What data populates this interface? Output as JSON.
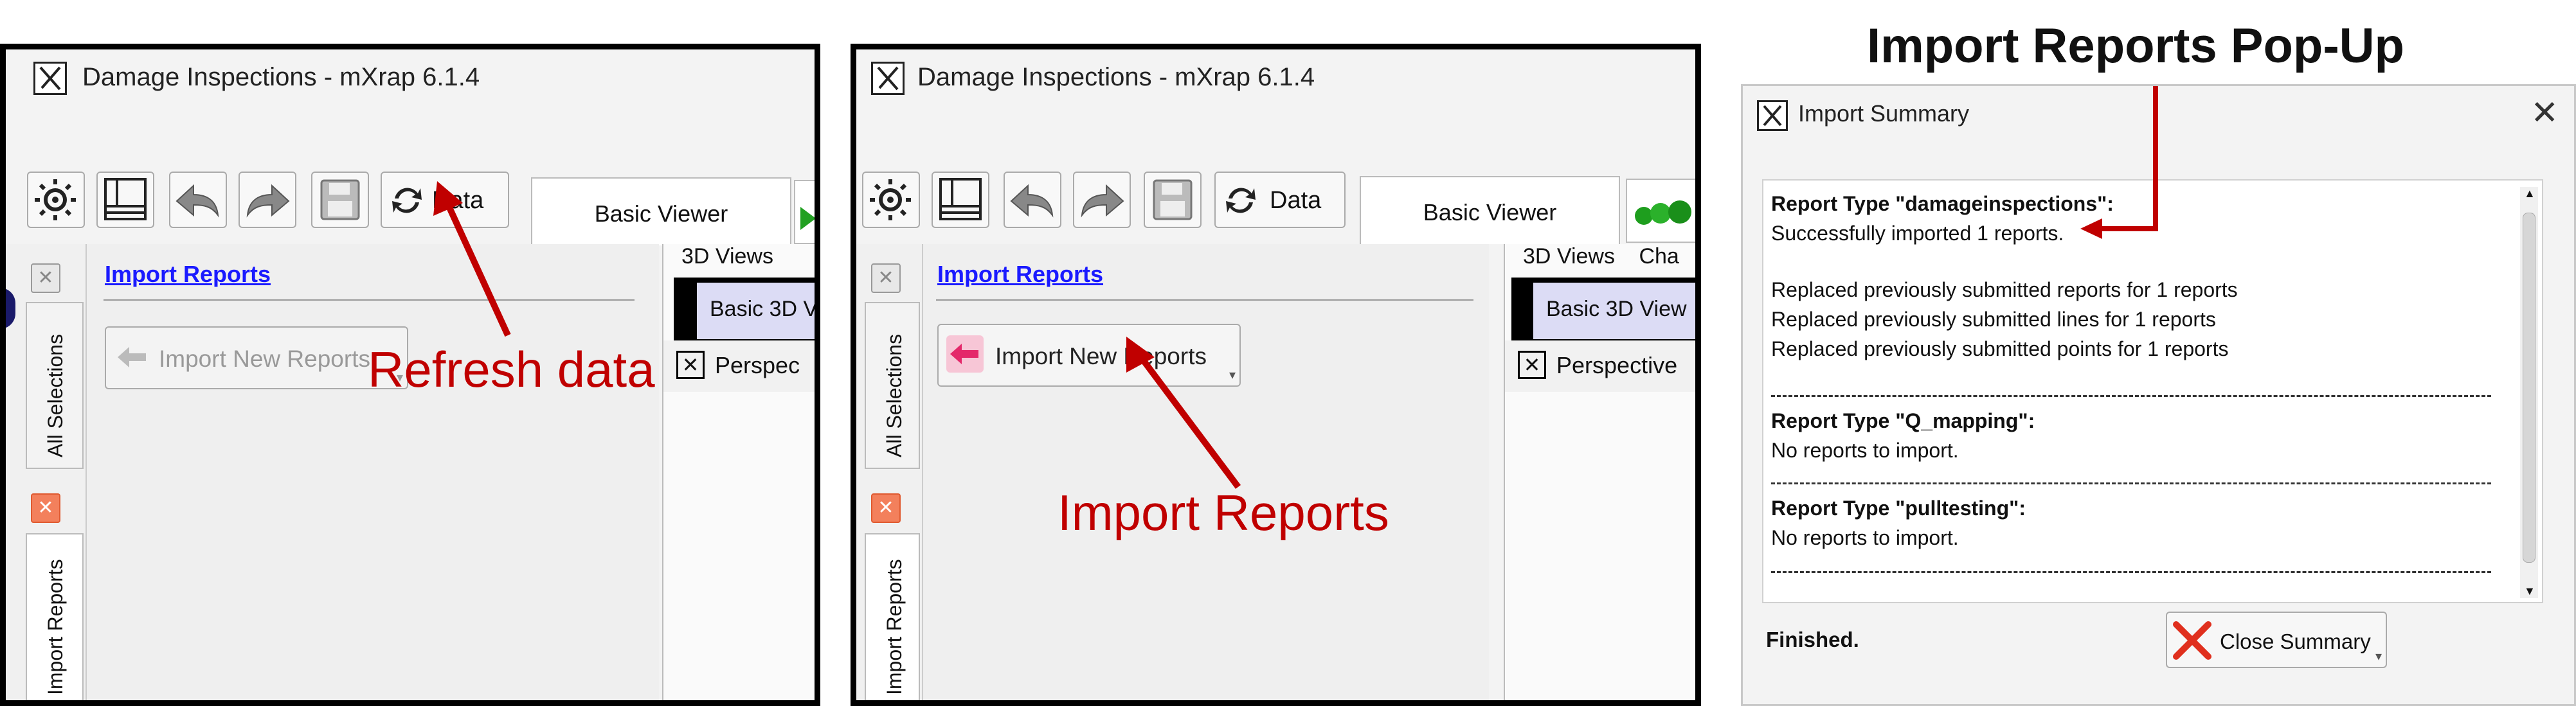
{
  "panel1": {
    "window_title": "Damage Inspections - mXrap 6.1.4",
    "data_button_label": "Data",
    "tab_basic_viewer": "Basic Viewer",
    "vtab_all_selections": "All Selections",
    "vtab_import_reports": "Import Reports",
    "import_reports_link": "Import Reports",
    "import_new_reports_label": "Import New Reports",
    "views_tab": "3D Views",
    "basic3d_tab": "Basic 3D V",
    "perspective_label": "Perspec",
    "annotation": "Refresh data"
  },
  "panel2": {
    "window_title": "Damage Inspections - mXrap 6.1.4",
    "data_button_label": "Data",
    "tab_basic_viewer": "Basic Viewer",
    "vtab_all_selections": "All Selections",
    "vtab_import_reports": "Import Reports",
    "import_reports_link": "Import Reports",
    "import_new_reports_label": "Import New Reports",
    "views_tab": "3D Views",
    "views_tab2": "Cha",
    "basic3d_tab": "Basic 3D View",
    "perspective_label": "Perspective",
    "annotation": "Import Reports"
  },
  "popup": {
    "heading": "Import Reports Pop-Up",
    "dialog_title": "Import Summary",
    "sections": [
      {
        "header": "Report Type \"damageinspections\":",
        "lines": [
          "Successfully imported 1 reports.",
          "",
          "Replaced previously submitted reports for 1 reports",
          "Replaced previously submitted lines for 1 reports",
          "Replaced previously submitted points for 1 reports"
        ]
      },
      {
        "header": "Report Type \"Q_mapping\":",
        "lines": [
          "No reports to import."
        ]
      },
      {
        "header": "Report Type \"pulltesting\":",
        "lines": [
          "No reports to import."
        ]
      }
    ],
    "status": "Finished.",
    "close_button_label": "Close Summary"
  },
  "colors": {
    "annotation_red": "#c00000",
    "link_blue": "#1a1aff",
    "close_x_red": "#e0301e",
    "arrow_pink": "#e4286a"
  },
  "icons": [
    "gear-icon",
    "layout-icon",
    "undo-icon",
    "redo-icon",
    "save-icon",
    "refresh-icon",
    "close-icon",
    "arrow-left-icon"
  ]
}
